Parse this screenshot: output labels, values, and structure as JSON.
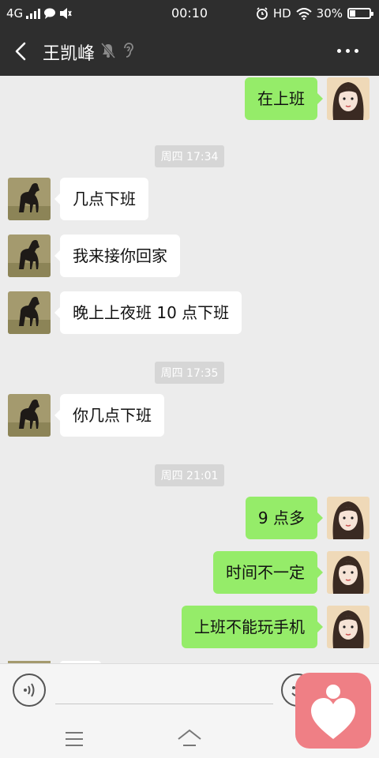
{
  "status_bar": {
    "network": "4G",
    "time": "00:10",
    "hd": "HD",
    "battery_text": "30%",
    "battery_level": 0.3
  },
  "header": {
    "title": "王凯峰",
    "icons": [
      "back-icon",
      "mute-icon",
      "ear-icon",
      "more-icon"
    ]
  },
  "messages": [
    {
      "side": "out",
      "text": "在上班"
    },
    {
      "timestamp": "周四 17:34"
    },
    {
      "side": "in",
      "text": "几点下班"
    },
    {
      "side": "in",
      "text": "我来接你回家"
    },
    {
      "side": "in",
      "text": "晚上上夜班 10 点下班"
    },
    {
      "timestamp": "周四 17:35"
    },
    {
      "side": "in",
      "text": "你几点下班"
    },
    {
      "timestamp": "周四 21:01"
    },
    {
      "side": "out",
      "text": "9 点多"
    },
    {
      "side": "out",
      "text": "时间不一定"
    },
    {
      "side": "out",
      "text": "上班不能玩手机"
    }
  ],
  "input_bar": {
    "icons": [
      "voice-icon",
      "emoji-icon",
      "plus-icon"
    ]
  },
  "nav_bar": {
    "icons": [
      "menu-icon",
      "home-icon"
    ]
  },
  "colors": {
    "header_bg": "#2e2e2e",
    "chat_bg": "#ececec",
    "outgoing_bubble": "#95ec69",
    "incoming_bubble": "#ffffff",
    "overlay_app": "#ef7f85"
  }
}
